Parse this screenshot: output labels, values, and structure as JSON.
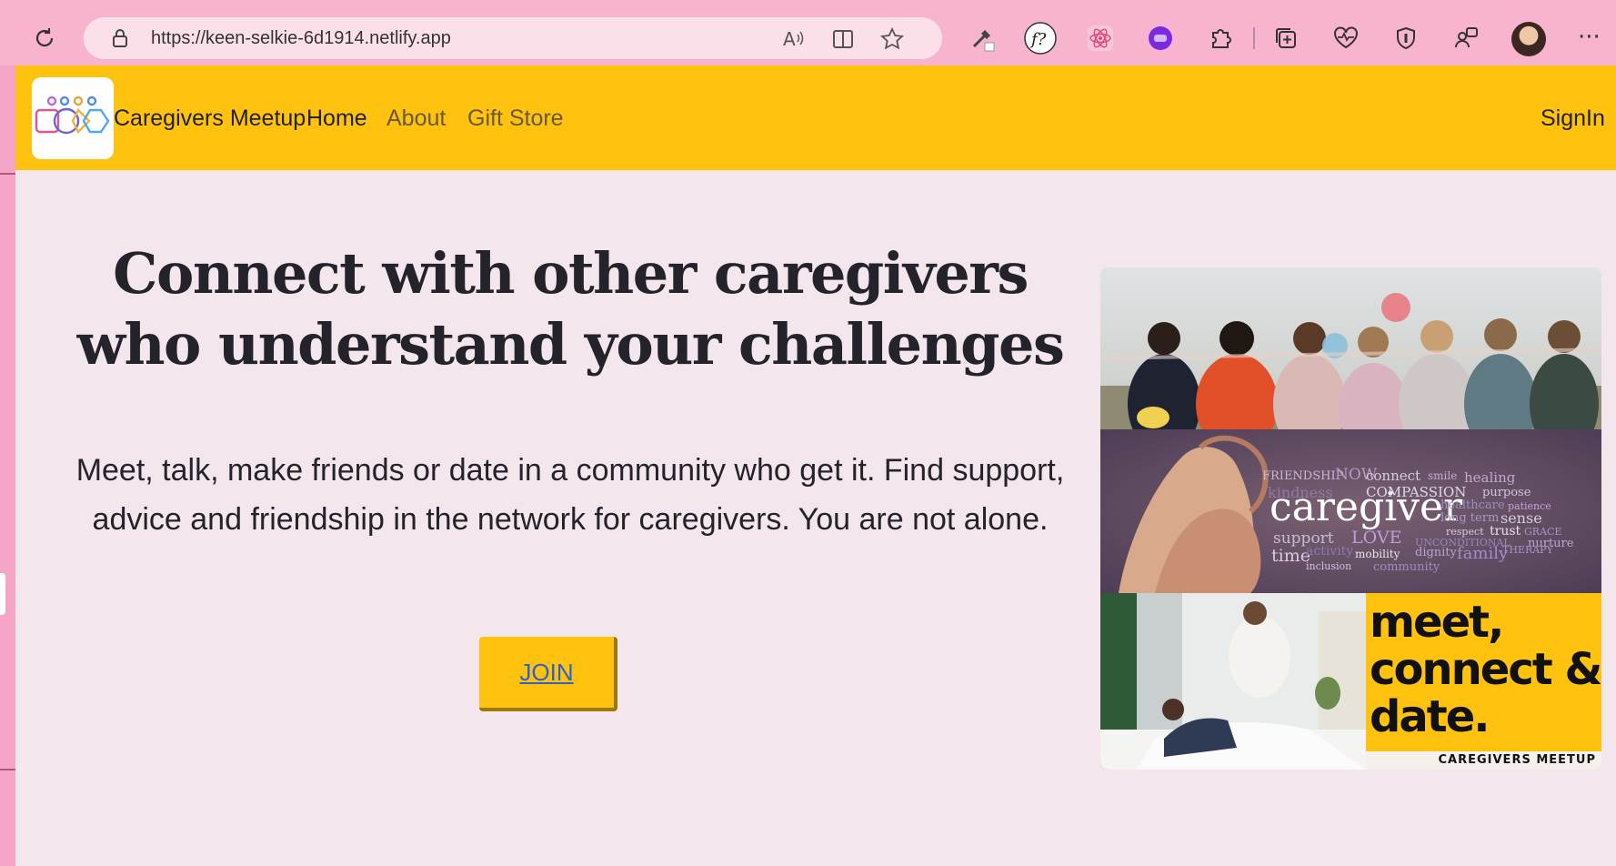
{
  "browser": {
    "url": "https://keen-selkie-6d1914.netlify.app",
    "toolbar_icons": [
      "reload-icon",
      "lock-icon",
      "read-aloud-icon",
      "split-screen-icon",
      "favorite-star-icon",
      "eyedropper-icon",
      "font-finder-icon",
      "react-devtools-icon",
      "extension-purple-icon",
      "extensions-puzzle-icon",
      "collections-icon",
      "browser-essentials-icon",
      "shield-icon",
      "profile-switch-icon",
      "user-avatar",
      "more-menu-icon"
    ],
    "more": "···"
  },
  "navbar": {
    "brand": "Caregivers Meetup",
    "links": [
      "Home",
      "About",
      "Gift Store"
    ],
    "signin": "SignIn",
    "colors": {
      "bar": "#fec20f"
    }
  },
  "hero": {
    "title": "Connect with other caregivers who understand your challenges",
    "subtitle": "Meet, talk, make friends or date in a community who get it. Find support, advice and friendship in the network for caregivers. You are not alone.",
    "join_label": "JOIN"
  },
  "collage": {
    "word_cloud_main": "caregiver",
    "word_cloud_words": [
      "FRIENDSHIP",
      "NOW",
      "connect",
      "smile",
      "healing",
      "kindness",
      "COMPASSION",
      "purpose",
      "healthcare",
      "patience",
      "support",
      "LOVE",
      "long term",
      "sense",
      "respect",
      "trust",
      "GRACE",
      "UNCONDITIONAL",
      "nurture",
      "time",
      "activity",
      "mobility",
      "dignity",
      "family",
      "THERAPY",
      "inclusion",
      "community"
    ],
    "poster_headline": "meet, connect & date.",
    "poster_footer": "CAREGIVERS MEETUP"
  },
  "colors": {
    "accent": "#fec20f",
    "page_bg": "#f4e6ed",
    "chrome_bg": "#f8b3cf",
    "link": "#2f62c7"
  }
}
